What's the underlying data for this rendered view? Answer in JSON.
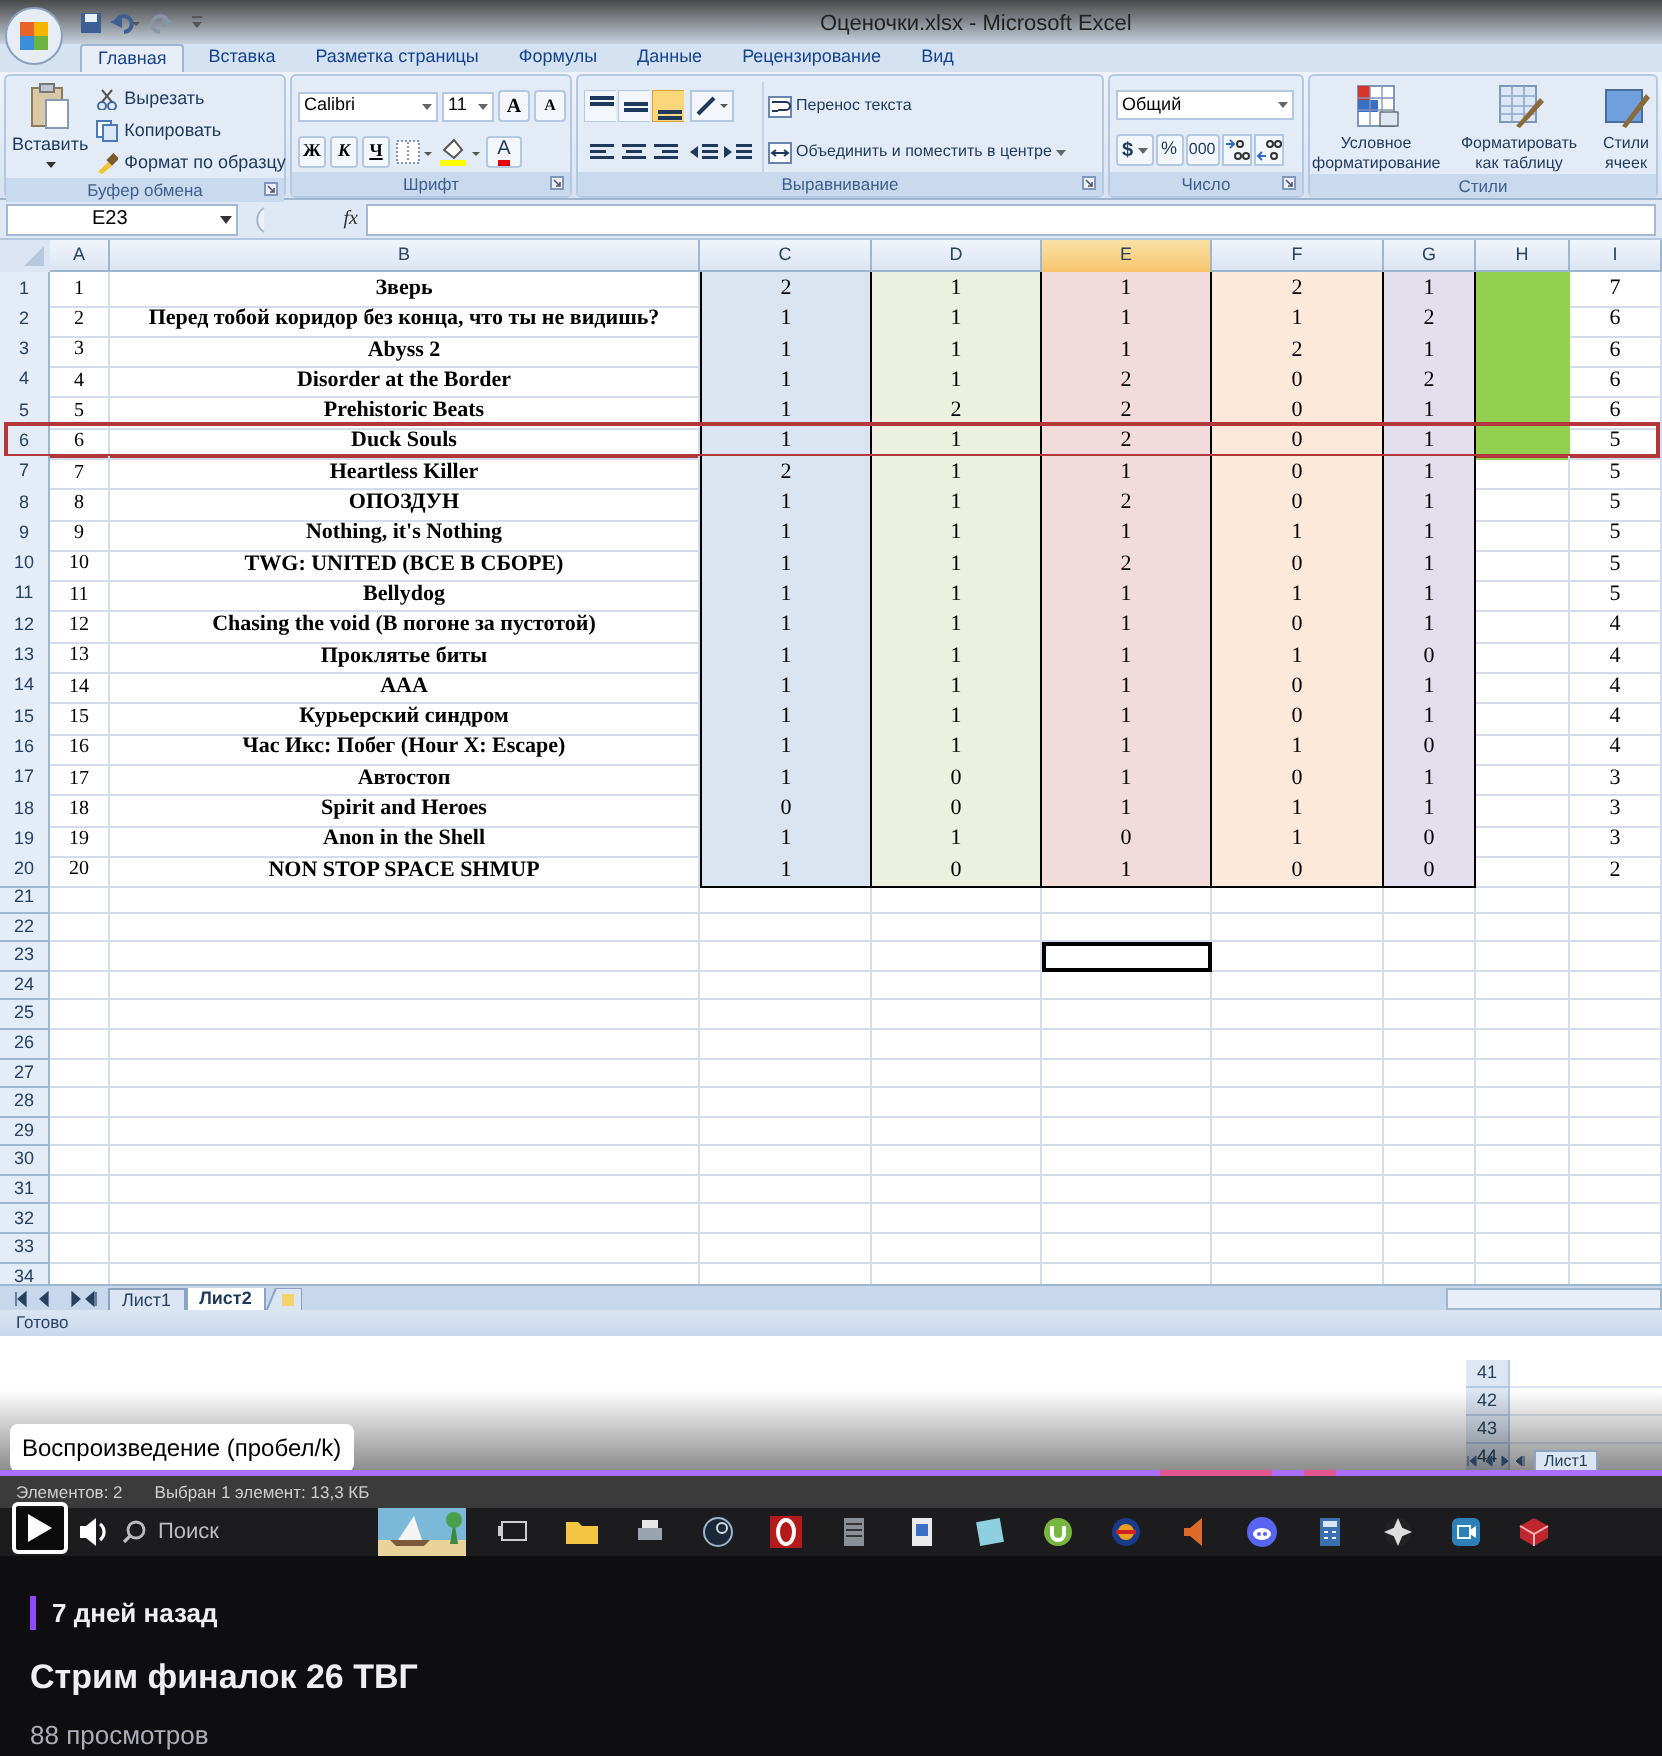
{
  "window": {
    "title": "Оценочки.xlsx - Microsoft Excel"
  },
  "ribbon_tabs": [
    {
      "label": "Главная",
      "selected": true
    },
    {
      "label": "Вставка",
      "selected": false
    },
    {
      "label": "Разметка страницы",
      "selected": false
    },
    {
      "label": "Формулы",
      "selected": false
    },
    {
      "label": "Данные",
      "selected": false
    },
    {
      "label": "Рецензирование",
      "selected": false
    },
    {
      "label": "Вид",
      "selected": false
    }
  ],
  "clipboard": {
    "paste": "Вставить",
    "items": [
      "Вырезать",
      "Копировать",
      "Формат по образцу"
    ],
    "label": "Буфер обмена"
  },
  "font": {
    "name": "Calibri",
    "size": "11",
    "grow": "A",
    "shrink": "A",
    "bold": "Ж",
    "italic": "К",
    "underline": "Ч",
    "font_color": "A",
    "label": "Шрифт"
  },
  "alignment": {
    "vertical": [
      {
        "kind": "top",
        "selected": false
      },
      {
        "kind": "middle",
        "selected": false
      },
      {
        "kind": "bottom",
        "selected": true
      }
    ],
    "wrap": "Перенос текста",
    "merge": "Объединить и поместить в центре",
    "label": "Выравнивание"
  },
  "number": {
    "format": "Общий",
    "currency": "$",
    "percent": "%",
    "thousands": "000",
    "label": "Число"
  },
  "styles": {
    "items": [
      "Условное форматирование",
      "Форматировать как таблицу",
      "Стили ячеек"
    ],
    "label": "Стили"
  },
  "formula_bar": {
    "name_box": "E23",
    "fx": "fx"
  },
  "columns": [
    {
      "label": "A",
      "kind": "index",
      "selected": false
    },
    {
      "label": "B",
      "kind": "title",
      "selected": false
    },
    {
      "label": "C",
      "kind": "score",
      "color": "#dbe5f1",
      "selected": false
    },
    {
      "label": "D",
      "kind": "score",
      "color": "#ebf1de",
      "selected": false
    },
    {
      "label": "E",
      "kind": "score",
      "color": "#f2dcdb",
      "selected": true
    },
    {
      "label": "F",
      "kind": "score",
      "color": "#fde9d9",
      "selected": false
    },
    {
      "label": "G",
      "kind": "score",
      "color": "#e4dfec",
      "selected": false
    },
    {
      "label": "H",
      "kind": "fill",
      "selected": false
    },
    {
      "label": "I",
      "kind": "total",
      "selected": false
    }
  ],
  "rows": [
    {
      "number": "1",
      "cells": [
        "1",
        "Зверь",
        "2",
        "1",
        "1",
        "2",
        "1",
        "7"
      ],
      "h_filled": true,
      "selected": false
    },
    {
      "number": "2",
      "cells": [
        "2",
        "Перед тобой коридор без конца, что ты не видишь?",
        "1",
        "1",
        "1",
        "1",
        "2",
        "6"
      ],
      "h_filled": true,
      "selected": false
    },
    {
      "number": "3",
      "cells": [
        "3",
        "Abyss 2",
        "1",
        "1",
        "1",
        "2",
        "1",
        "6"
      ],
      "h_filled": true,
      "selected": false
    },
    {
      "number": "4",
      "cells": [
        "4",
        "Disorder at the Border",
        "1",
        "1",
        "2",
        "0",
        "2",
        "6"
      ],
      "h_filled": true,
      "selected": false
    },
    {
      "number": "5",
      "cells": [
        "5",
        "Prehistoric Beats",
        "1",
        "2",
        "2",
        "0",
        "1",
        "6"
      ],
      "h_filled": true,
      "selected": false
    },
    {
      "number": "6",
      "cells": [
        "6",
        "Duck Souls",
        "1",
        "1",
        "2",
        "0",
        "1",
        "5"
      ],
      "h_filled": true,
      "selected": true
    },
    {
      "number": "7",
      "cells": [
        "7",
        "Heartless Killer",
        "2",
        "1",
        "1",
        "0",
        "1",
        "5"
      ],
      "h_filled": false,
      "selected": false
    },
    {
      "number": "8",
      "cells": [
        "8",
        "ОПОЗДУН",
        "1",
        "1",
        "2",
        "0",
        "1",
        "5"
      ],
      "h_filled": false,
      "selected": false
    },
    {
      "number": "9",
      "cells": [
        "9",
        "Nothing, it's Nothing",
        "1",
        "1",
        "1",
        "1",
        "1",
        "5"
      ],
      "h_filled": false,
      "selected": false
    },
    {
      "number": "10",
      "cells": [
        "10",
        "TWG: UNITED (ВСЕ В СБОРЕ)",
        "1",
        "1",
        "2",
        "0",
        "1",
        "5"
      ],
      "h_filled": false,
      "selected": false
    },
    {
      "number": "11",
      "cells": [
        "11",
        "Bellydog",
        "1",
        "1",
        "1",
        "1",
        "1",
        "5"
      ],
      "h_filled": false,
      "selected": false
    },
    {
      "number": "12",
      "cells": [
        "12",
        "Chasing the void (В погоне за пустотой)",
        "1",
        "1",
        "1",
        "0",
        "1",
        "4"
      ],
      "h_filled": false,
      "selected": false
    },
    {
      "number": "13",
      "cells": [
        "13",
        "Проклятье биты",
        "1",
        "1",
        "1",
        "1",
        "0",
        "4"
      ],
      "h_filled": false,
      "selected": false
    },
    {
      "number": "14",
      "cells": [
        "14",
        "AAA",
        "1",
        "1",
        "1",
        "0",
        "1",
        "4"
      ],
      "h_filled": false,
      "selected": false
    },
    {
      "number": "15",
      "cells": [
        "15",
        "Курьерский синдром",
        "1",
        "1",
        "1",
        "0",
        "1",
        "4"
      ],
      "h_filled": false,
      "selected": false
    },
    {
      "number": "16",
      "cells": [
        "16",
        "Час Икс: Побег (Hour X: Escape)",
        "1",
        "1",
        "1",
        "1",
        "0",
        "4"
      ],
      "h_filled": false,
      "selected": false
    },
    {
      "number": "17",
      "cells": [
        "17",
        "Автостоп",
        "1",
        "0",
        "1",
        "0",
        "1",
        "3"
      ],
      "h_filled": false,
      "selected": false
    },
    {
      "number": "18",
      "cells": [
        "18",
        "Spirit and Heroes",
        "0",
        "0",
        "1",
        "1",
        "1",
        "3"
      ],
      "h_filled": false,
      "selected": false
    },
    {
      "number": "19",
      "cells": [
        "19",
        "Anon in the Shell",
        "1",
        "1",
        "0",
        "1",
        "0",
        "3"
      ],
      "h_filled": false,
      "selected": false
    },
    {
      "number": "20",
      "cells": [
        "20",
        "NON STOP SPACE SHMUP",
        "1",
        "0",
        "1",
        "0",
        "0",
        "2"
      ],
      "h_filled": false,
      "selected": false
    }
  ],
  "empty_rows": [
    {
      "number": "21",
      "selected": false
    },
    {
      "number": "22",
      "selected": false
    },
    {
      "number": "23",
      "selected": true
    },
    {
      "number": "24",
      "selected": false
    },
    {
      "number": "25",
      "selected": false
    },
    {
      "number": "26",
      "selected": false
    },
    {
      "number": "27",
      "selected": false
    },
    {
      "number": "28",
      "selected": false
    },
    {
      "number": "29",
      "selected": false
    },
    {
      "number": "30",
      "selected": false
    },
    {
      "number": "31",
      "selected": false
    },
    {
      "number": "32",
      "selected": false
    },
    {
      "number": "33",
      "selected": false
    },
    {
      "number": "34",
      "selected": false
    }
  ],
  "sheet_tabs": [
    {
      "label": "Лист1",
      "selected": false
    },
    {
      "label": "Лист2",
      "selected": true
    }
  ],
  "status_bar": {
    "text": "Готово"
  },
  "background_window": {
    "row_numbers": [
      "41",
      "42",
      "43",
      "44"
    ],
    "sheet_tab": "Лист1",
    "file_status": [
      "Элементов: 2",
      "Выбран 1 элемент: 13,3 КБ"
    ]
  },
  "player": {
    "tooltip": "Воспроизведение (пробел/k)",
    "search": "Поиск"
  },
  "video_info": {
    "age": "7 дней назад",
    "title": "Стрим финалок 26 ТВГ",
    "views": "88 просмотров"
  }
}
